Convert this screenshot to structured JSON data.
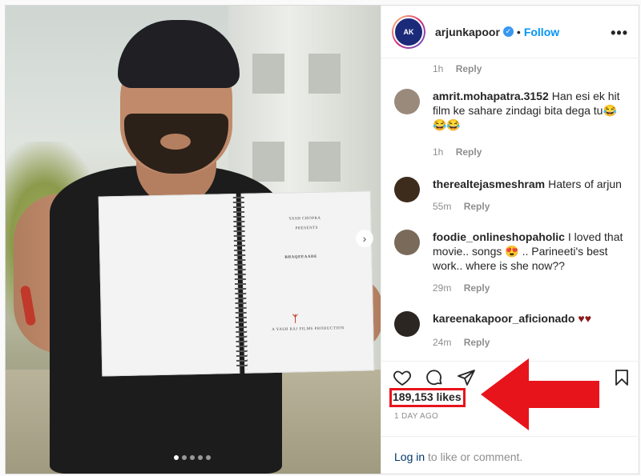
{
  "post": {
    "username": "arjunkapoor",
    "follow_label": "Follow",
    "more_label": "•••",
    "avatar_text": "AK",
    "carousel_next": "›",
    "carousel_dots": 5
  },
  "script_pages": {
    "title": "BHAQEEAADE",
    "studio": "YASH CHOPRA",
    "presents": "PRESENTS",
    "tagline": "A YASH RAJ FILMS PRODUCTION"
  },
  "comments_top_meta": {
    "time": "1h",
    "reply": "Reply"
  },
  "comments": [
    {
      "user": "amrit.mohapatra.3152",
      "text": "Han esi ek hit film ke sahare zindagi bita dega tu😂 😂😂",
      "time": "1h",
      "reply": "Reply",
      "avatar_color": "#9a8a7c"
    },
    {
      "user": "therealtejasmeshram",
      "text": "Haters of arjun",
      "time": "55m",
      "reply": "Reply",
      "avatar_color": "#3d2b1c"
    },
    {
      "user": "foodie_onlineshopaholic",
      "text": "I loved that movie.. songs 😍 .. Parineeti's best work.. where is she now??",
      "time": "29m",
      "reply": "Reply",
      "avatar_color": "#7a6a5a"
    },
    {
      "user": "kareenakapoor_aficionado",
      "text": "♥♥",
      "time": "24m",
      "reply": "Reply",
      "avatar_color": "#2c2622"
    }
  ],
  "engagement": {
    "likes": "189,153 likes",
    "time_ago": "1 DAY AGO"
  },
  "login_bar": {
    "link": "Log in",
    "rest": " to like or comment."
  },
  "colors": {
    "follow": "#0095f6",
    "annotation": "#e8141b",
    "verified": "#3897f0"
  }
}
